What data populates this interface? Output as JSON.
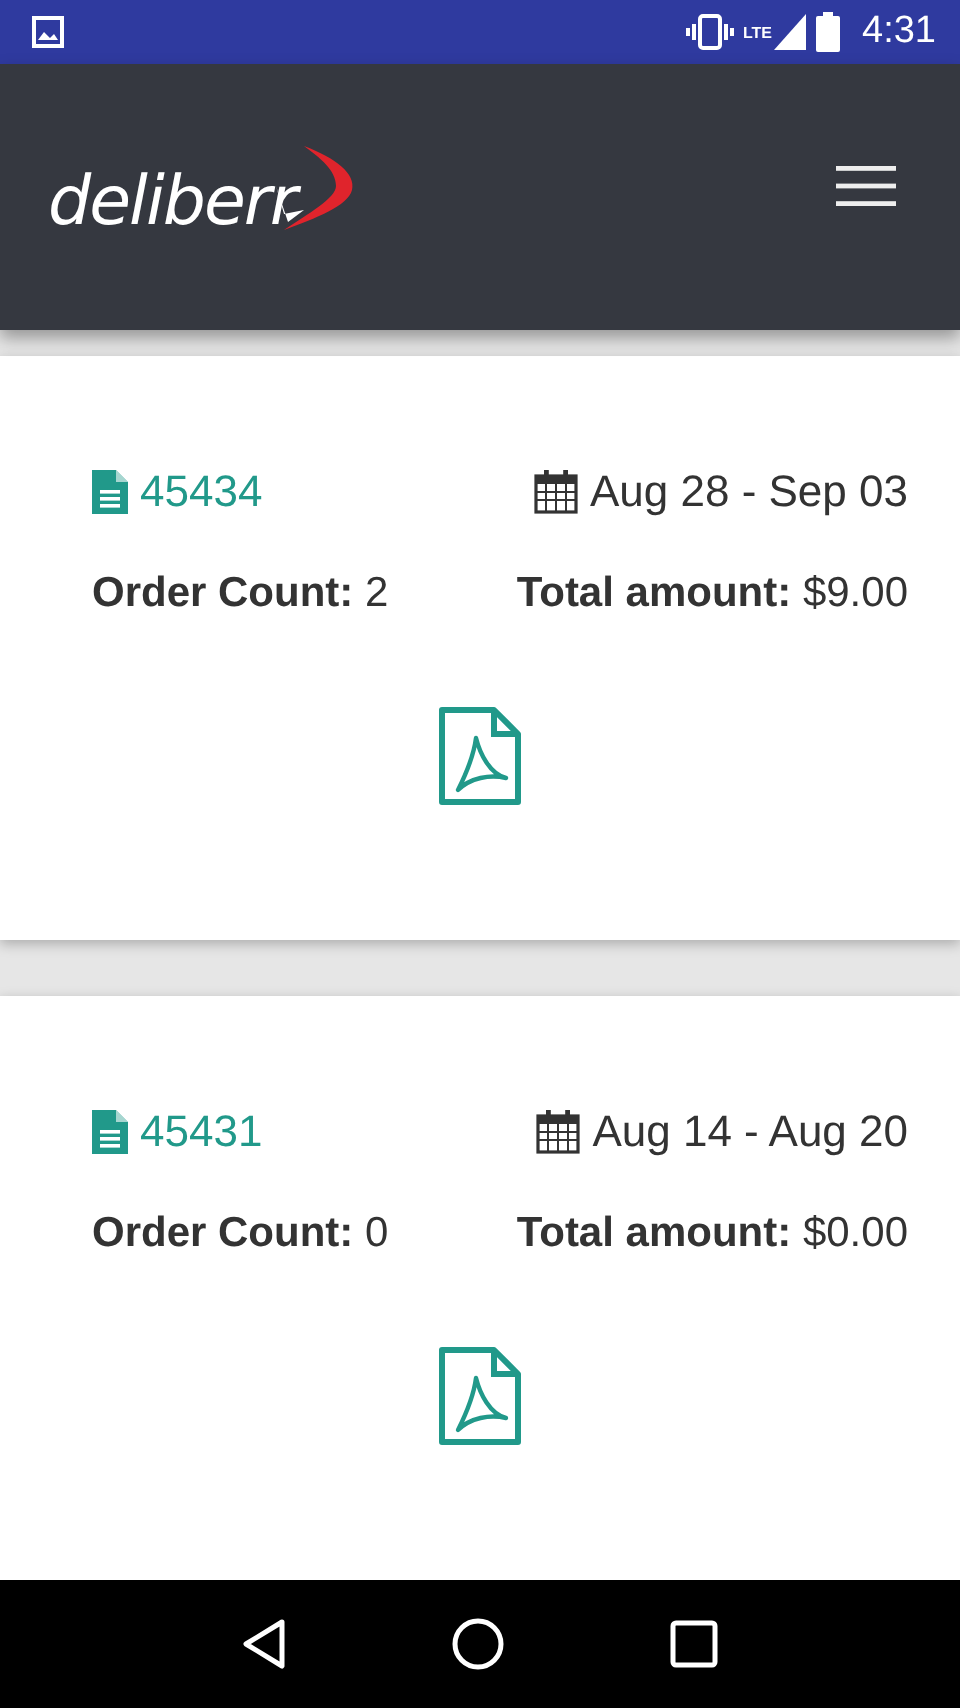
{
  "status_bar": {
    "network": "LTE",
    "time": "4:31"
  },
  "header": {
    "logo": "deliberr"
  },
  "invoices": [
    {
      "number": "45434",
      "dates": "Aug 28 - Sep 03",
      "order_count": "**Order Count:** 2",
      "total": "**Total amount:** $9.00"
    },
    {
      "number": "45431",
      "dates": "Aug 14 - Aug 20",
      "order_count": "**Order Count:** 0",
      "total": "**Total amount:** $0.00"
    }
  ]
}
